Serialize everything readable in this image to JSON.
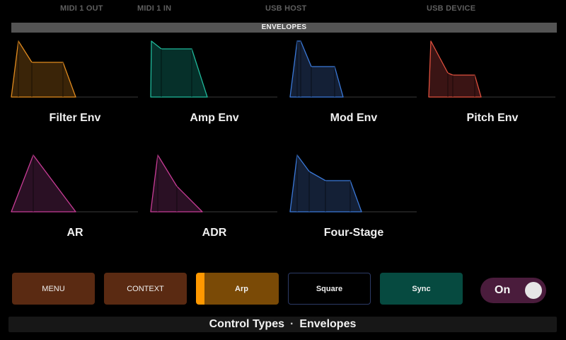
{
  "top_bar": {
    "midi_out": "MIDI 1 OUT",
    "midi_in": "MIDI 1 IN",
    "usb_host": "USB HOST",
    "usb_device": "USB DEVICE"
  },
  "section": {
    "title": "ENVELOPES"
  },
  "envelopes": [
    {
      "label": "Filter Env",
      "color": "#e08a1e",
      "fill": "#3a2408",
      "shape": "filter"
    },
    {
      "label": "Amp Env",
      "color": "#1fb89a",
      "fill": "#06302a",
      "shape": "amp"
    },
    {
      "label": "Mod Env",
      "color": "#3a78d8",
      "fill": "#142036",
      "shape": "mod"
    },
    {
      "label": "Pitch Env",
      "color": "#e0503e",
      "fill": "#3a1414",
      "shape": "pitch"
    },
    {
      "label": "AR",
      "color": "#c83c96",
      "fill": "#2a1024",
      "shape": "ar"
    },
    {
      "label": "ADR",
      "color": "#c83c96",
      "fill": "#2a1024",
      "shape": "adr"
    },
    {
      "label": "Four-Stage",
      "color": "#3a78d8",
      "fill": "#142036",
      "shape": "four"
    }
  ],
  "buttons": {
    "menu": "MENU",
    "context": "CONTEXT",
    "arp": "Arp",
    "square": "Square",
    "sync": "Sync"
  },
  "toggle": {
    "label": "On",
    "state": "on"
  },
  "footer": {
    "left": "Control Types",
    "separator": "·",
    "right": "Envelopes"
  }
}
